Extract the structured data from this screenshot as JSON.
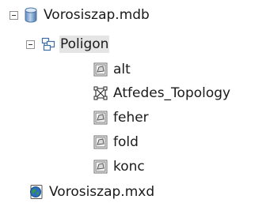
{
  "tree": {
    "database": {
      "label": "Vorosiszap.mdb",
      "icon": "database-cylinder-icon",
      "expanded": true,
      "dataset": {
        "label": "Poligon",
        "icon": "feature-dataset-icon",
        "expanded": true,
        "children": [
          {
            "label": "alt",
            "icon": "polygon-feature-class-icon"
          },
          {
            "label": "Atfedes_Topology",
            "icon": "topology-icon"
          },
          {
            "label": "feher",
            "icon": "polygon-feature-class-icon"
          },
          {
            "label": "fold",
            "icon": "polygon-feature-class-icon"
          },
          {
            "label": "konc",
            "icon": "polygon-feature-class-icon"
          }
        ]
      }
    },
    "map_document": {
      "label": "Vorosiszap.mxd",
      "icon": "map-document-globe-icon"
    }
  },
  "colors": {
    "cylinder_fill": "#8db3dc",
    "cylinder_edge": "#4f77a5",
    "dataset_edge": "#3e6ea3",
    "fc_border": "#6c6c6c",
    "globe_blue": "#2b6fbe",
    "globe_green": "#3e9a3a"
  }
}
